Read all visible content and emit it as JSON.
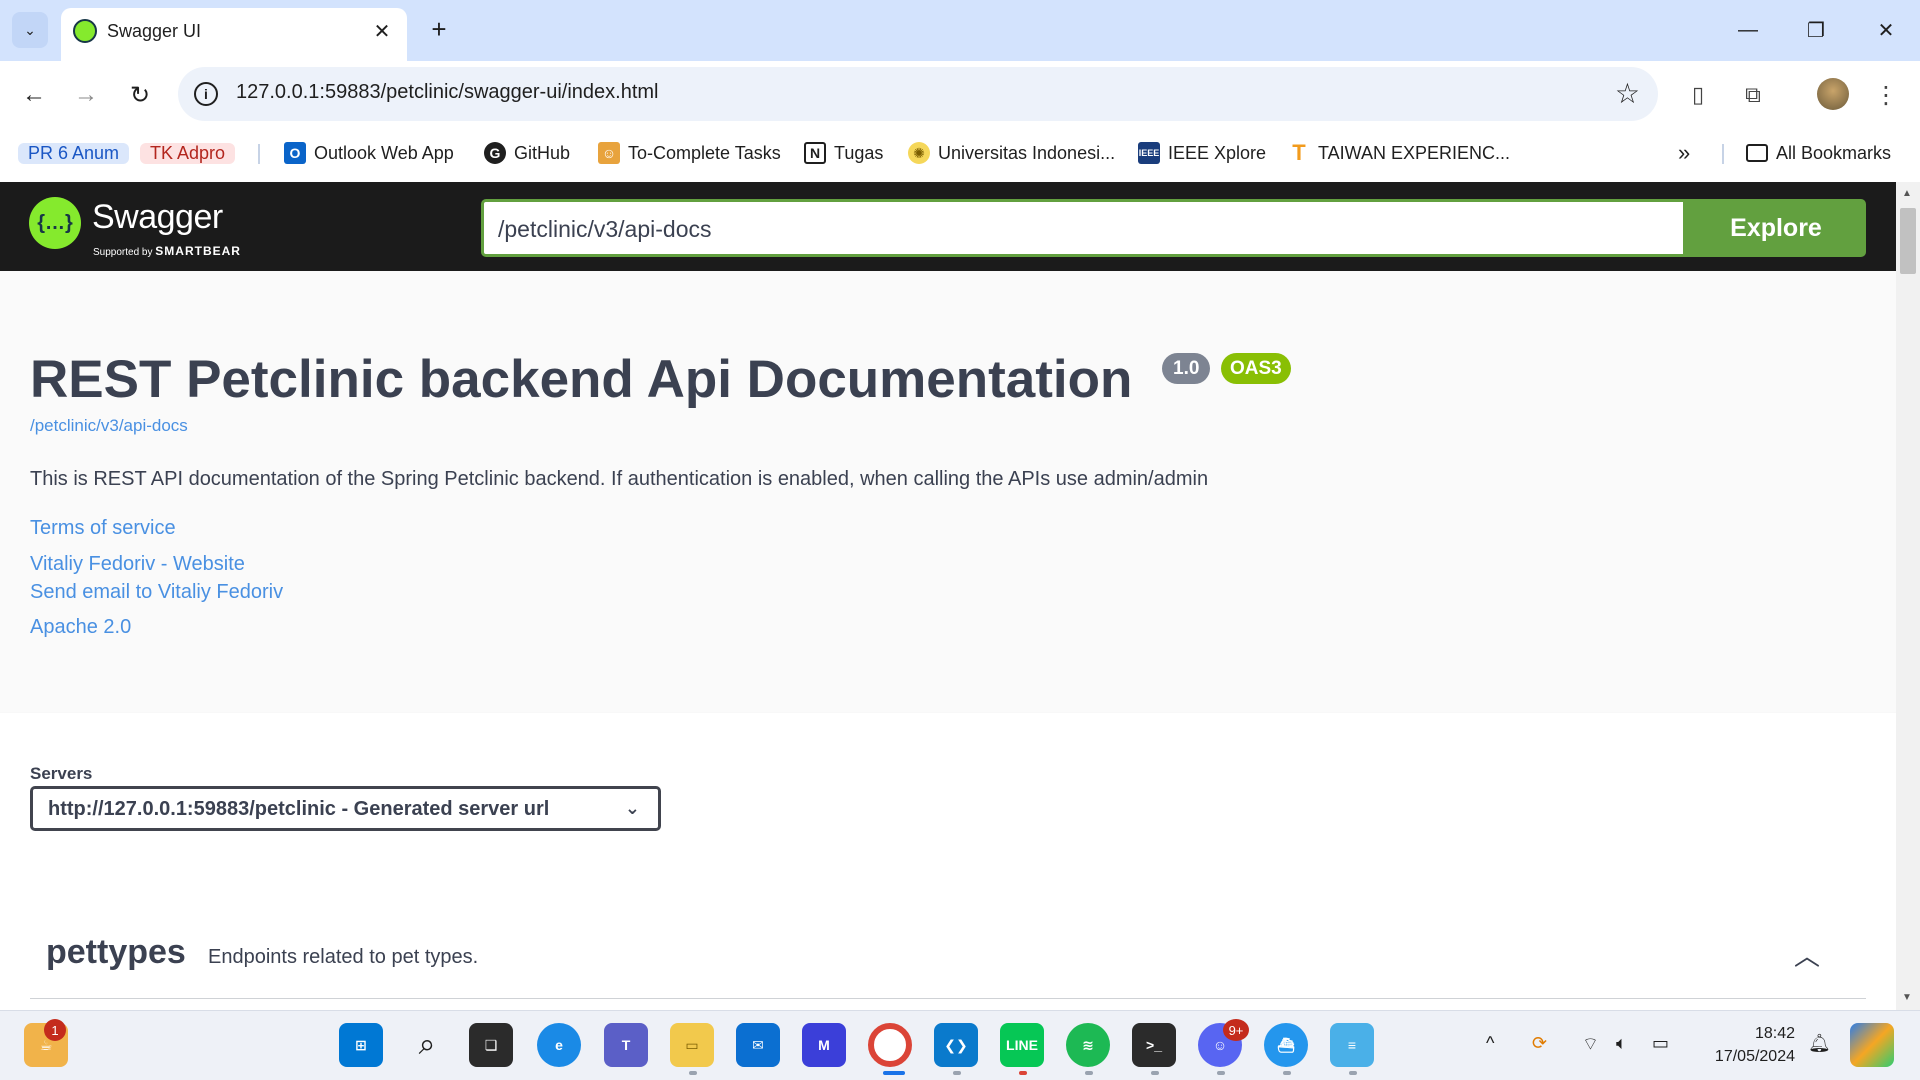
{
  "browser": {
    "tab_title": "Swagger UI",
    "url": "127.0.0.1:59883/petclinic/swagger-ui/index.html",
    "bookmarks": {
      "chip1": "PR 6 Anum",
      "chip2": "TK Adpro",
      "items": [
        "Outlook Web App",
        "GitHub",
        "To-Complete Tasks",
        "Tugas",
        "Universitas Indonesi...",
        "IEEE Xplore",
        "TAIWAN EXPERIENC..."
      ],
      "more": "»",
      "all_bookmarks": "All Bookmarks"
    }
  },
  "swagger": {
    "logo_text": "Swagger",
    "logo_sub_prefix": "Supported by",
    "logo_sub_brand": "SMARTBEAR",
    "spec_url": "/petclinic/v3/api-docs",
    "explore_label": "Explore",
    "title": "REST Petclinic backend Api Documentation",
    "version_badge": "1.0",
    "oas_badge": "OAS3",
    "spec_link": "/petclinic/v3/api-docs",
    "description": "This is REST API documentation of the Spring Petclinic backend. If authentication is enabled, when calling the APIs use admin/admin",
    "links": {
      "terms": "Terms of service",
      "website": "Vitaliy Fedoriv - Website",
      "email": "Send email to Vitaliy Fedoriv",
      "license": "Apache 2.0"
    },
    "servers": {
      "label": "Servers",
      "selected": "http://127.0.0.1:59883/petclinic - Generated server url"
    },
    "tag": {
      "name": "pettypes",
      "description": "Endpoints related to pet types."
    }
  },
  "taskbar": {
    "notification_count": "1",
    "discord_badge": "9+",
    "time": "18:42",
    "date": "17/05/2024"
  },
  "colors": {
    "swagger_green": "#62a03f",
    "swagger_dark": "#1b1b1b",
    "link_blue": "#4990e2",
    "oas_green": "#89bf04",
    "version_grey": "#7d8492"
  }
}
